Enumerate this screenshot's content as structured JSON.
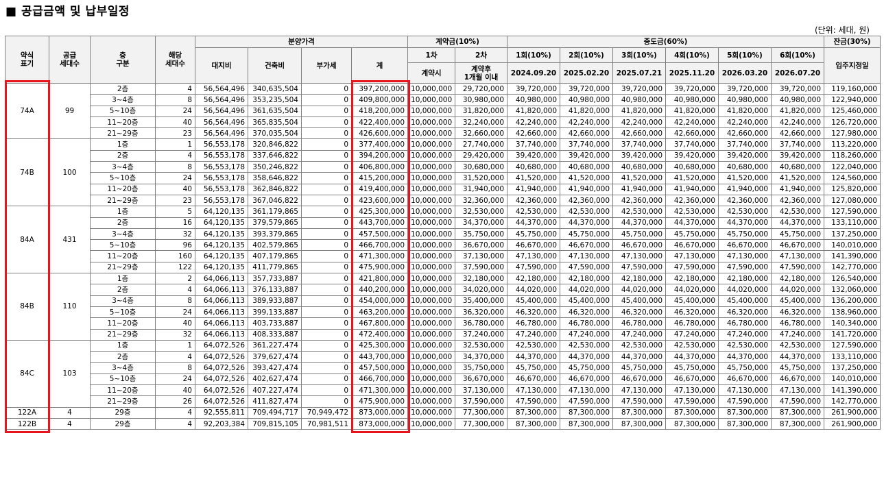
{
  "title": "■ 공급금액 및 납부일정",
  "unit_note": "(단위: 세대, 원)",
  "headers": {
    "type": "약식\n표기",
    "supply": "공급\n세대수",
    "floor": "층\n구분",
    "units": "해당\n세대수",
    "price_group": "분양가격",
    "land": "대지비",
    "building": "건축비",
    "vat": "부가세",
    "total": "계",
    "deposit_group": "계약금(10%)",
    "dep1": "1차",
    "dep2": "2차",
    "dep1_sub": "계약시",
    "dep2_sub": "계약후\n1개월 이내",
    "mid_group": "중도금(60%)",
    "mid_rounds": [
      "1회(10%)",
      "2회(10%)",
      "3회(10%)",
      "4회(10%)",
      "5회(10%)",
      "6회(10%)"
    ],
    "mid_dates": [
      "2024.09.20",
      "2025.02.20",
      "2025.07.21",
      "2025.11.20",
      "2026.03.20",
      "2026.07.20"
    ],
    "balance_group": "잔금(30%)",
    "balance_sub": "입주지정일"
  },
  "groups": [
    {
      "type": "74A",
      "supply": "99",
      "rows": [
        [
          "2층",
          "4",
          "56,564,496",
          "340,635,504",
          "0",
          "397,200,000",
          "10,000,000",
          "29,720,000",
          "39,720,000",
          "119,160,000"
        ],
        [
          "3~4층",
          "8",
          "56,564,496",
          "353,235,504",
          "0",
          "409,800,000",
          "10,000,000",
          "30,980,000",
          "40,980,000",
          "122,940,000"
        ],
        [
          "5~10층",
          "24",
          "56,564,496",
          "361,635,504",
          "0",
          "418,200,000",
          "10,000,000",
          "31,820,000",
          "41,820,000",
          "125,460,000"
        ],
        [
          "11~20층",
          "40",
          "56,564,496",
          "365,835,504",
          "0",
          "422,400,000",
          "10,000,000",
          "32,240,000",
          "42,240,000",
          "126,720,000"
        ],
        [
          "21~29층",
          "23",
          "56,564,496",
          "370,035,504",
          "0",
          "426,600,000",
          "10,000,000",
          "32,660,000",
          "42,660,000",
          "127,980,000"
        ]
      ]
    },
    {
      "type": "74B",
      "supply": "100",
      "rows": [
        [
          "1층",
          "1",
          "56,553,178",
          "320,846,822",
          "0",
          "377,400,000",
          "10,000,000",
          "27,740,000",
          "37,740,000",
          "113,220,000"
        ],
        [
          "2층",
          "4",
          "56,553,178",
          "337,646,822",
          "0",
          "394,200,000",
          "10,000,000",
          "29,420,000",
          "39,420,000",
          "118,260,000"
        ],
        [
          "3~4층",
          "8",
          "56,553,178",
          "350,246,822",
          "0",
          "406,800,000",
          "10,000,000",
          "30,680,000",
          "40,680,000",
          "122,040,000"
        ],
        [
          "5~10층",
          "24",
          "56,553,178",
          "358,646,822",
          "0",
          "415,200,000",
          "10,000,000",
          "31,520,000",
          "41,520,000",
          "124,560,000"
        ],
        [
          "11~20층",
          "40",
          "56,553,178",
          "362,846,822",
          "0",
          "419,400,000",
          "10,000,000",
          "31,940,000",
          "41,940,000",
          "125,820,000"
        ],
        [
          "21~29층",
          "23",
          "56,553,178",
          "367,046,822",
          "0",
          "423,600,000",
          "10,000,000",
          "32,360,000",
          "42,360,000",
          "127,080,000"
        ]
      ]
    },
    {
      "type": "84A",
      "supply": "431",
      "rows": [
        [
          "1층",
          "5",
          "64,120,135",
          "361,179,865",
          "0",
          "425,300,000",
          "10,000,000",
          "32,530,000",
          "42,530,000",
          "127,590,000"
        ],
        [
          "2층",
          "16",
          "64,120,135",
          "379,579,865",
          "0",
          "443,700,000",
          "10,000,000",
          "34,370,000",
          "44,370,000",
          "133,110,000"
        ],
        [
          "3~4층",
          "32",
          "64,120,135",
          "393,379,865",
          "0",
          "457,500,000",
          "10,000,000",
          "35,750,000",
          "45,750,000",
          "137,250,000"
        ],
        [
          "5~10층",
          "96",
          "64,120,135",
          "402,579,865",
          "0",
          "466,700,000",
          "10,000,000",
          "36,670,000",
          "46,670,000",
          "140,010,000"
        ],
        [
          "11~20층",
          "160",
          "64,120,135",
          "407,179,865",
          "0",
          "471,300,000",
          "10,000,000",
          "37,130,000",
          "47,130,000",
          "141,390,000"
        ],
        [
          "21~29층",
          "122",
          "64,120,135",
          "411,779,865",
          "0",
          "475,900,000",
          "10,000,000",
          "37,590,000",
          "47,590,000",
          "142,770,000"
        ]
      ]
    },
    {
      "type": "84B",
      "supply": "110",
      "rows": [
        [
          "1층",
          "2",
          "64,066,113",
          "357,733,887",
          "0",
          "421,800,000",
          "10,000,000",
          "32,180,000",
          "42,180,000",
          "126,540,000"
        ],
        [
          "2층",
          "4",
          "64,066,113",
          "376,133,887",
          "0",
          "440,200,000",
          "10,000,000",
          "34,020,000",
          "44,020,000",
          "132,060,000"
        ],
        [
          "3~4층",
          "8",
          "64,066,113",
          "389,933,887",
          "0",
          "454,000,000",
          "10,000,000",
          "35,400,000",
          "45,400,000",
          "136,200,000"
        ],
        [
          "5~10층",
          "24",
          "64,066,113",
          "399,133,887",
          "0",
          "463,200,000",
          "10,000,000",
          "36,320,000",
          "46,320,000",
          "138,960,000"
        ],
        [
          "11~20층",
          "40",
          "64,066,113",
          "403,733,887",
          "0",
          "467,800,000",
          "10,000,000",
          "36,780,000",
          "46,780,000",
          "140,340,000"
        ],
        [
          "21~29층",
          "32",
          "64,066,113",
          "408,333,887",
          "0",
          "472,400,000",
          "10,000,000",
          "37,240,000",
          "47,240,000",
          "141,720,000"
        ]
      ]
    },
    {
      "type": "84C",
      "supply": "103",
      "rows": [
        [
          "1층",
          "1",
          "64,072,526",
          "361,227,474",
          "0",
          "425,300,000",
          "10,000,000",
          "32,530,000",
          "42,530,000",
          "127,590,000"
        ],
        [
          "2층",
          "4",
          "64,072,526",
          "379,627,474",
          "0",
          "443,700,000",
          "10,000,000",
          "34,370,000",
          "44,370,000",
          "133,110,000"
        ],
        [
          "3~4층",
          "8",
          "64,072,526",
          "393,427,474",
          "0",
          "457,500,000",
          "10,000,000",
          "35,750,000",
          "45,750,000",
          "137,250,000"
        ],
        [
          "5~10층",
          "24",
          "64,072,526",
          "402,627,474",
          "0",
          "466,700,000",
          "10,000,000",
          "36,670,000",
          "46,670,000",
          "140,010,000"
        ],
        [
          "11~20층",
          "40",
          "64,072,526",
          "407,227,474",
          "0",
          "471,300,000",
          "10,000,000",
          "37,130,000",
          "47,130,000",
          "141,390,000"
        ],
        [
          "21~29층",
          "26",
          "64,072,526",
          "411,827,474",
          "0",
          "475,900,000",
          "10,000,000",
          "37,590,000",
          "47,590,000",
          "142,770,000"
        ]
      ]
    },
    {
      "type": "122A",
      "supply": "4",
      "rows": [
        [
          "29층",
          "4",
          "92,555,811",
          "709,494,717",
          "70,949,472",
          "873,000,000",
          "10,000,000",
          "77,300,000",
          "87,300,000",
          "261,900,000"
        ]
      ]
    },
    {
      "type": "122B",
      "supply": "4",
      "rows": [
        [
          "29층",
          "4",
          "92,203,384",
          "709,815,105",
          "70,981,511",
          "873,000,000",
          "10,000,000",
          "77,300,000",
          "87,300,000",
          "261,900,000"
        ]
      ]
    }
  ],
  "highlight_color": "#e8141c"
}
